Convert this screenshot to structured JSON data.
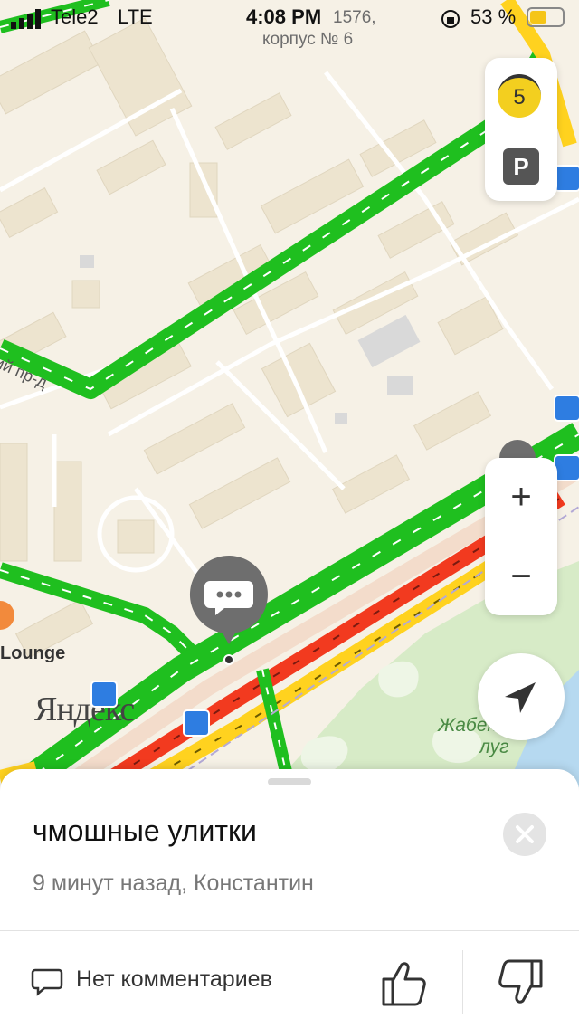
{
  "status_bar": {
    "carrier": "Tele2",
    "network": "LTE",
    "time": "4:08 PM",
    "battery_percent": "53 %",
    "battery_level": 0.53
  },
  "map": {
    "address_line1": "1576,",
    "address_line2": "корпус № 6",
    "street_label": "ий пр-д",
    "place_lounge": "Lounge",
    "park_line1": "Жабенский",
    "park_line2": "луг",
    "logo": "Яндекс",
    "traffic_score": "5",
    "parking_label": "P",
    "zoom_in": "+",
    "zoom_out": "−",
    "colors": {
      "green": "#1fbf1f",
      "yellow": "#ffd21f",
      "red": "#f23a1f",
      "background": "#f6f1e6",
      "park": "#d7ebc7",
      "water": "#b6d9f0"
    }
  },
  "sheet": {
    "title": "чмошные улитки",
    "subtitle": "9 минут назад, Константин",
    "comments_label": "Нет комментариев"
  },
  "icons": {
    "close": "close-icon",
    "like": "thumbs-up-icon",
    "dislike": "thumbs-down-icon",
    "comment": "comment-icon",
    "chat": "chat-bubble-icon",
    "location": "location-arrow-icon",
    "bus": "bus-stop-icon"
  }
}
